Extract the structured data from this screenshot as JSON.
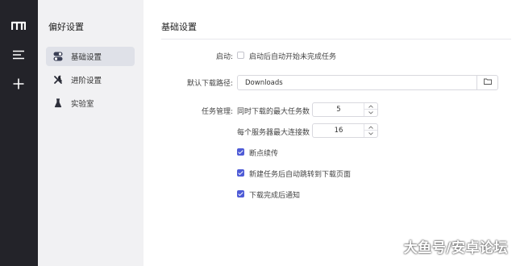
{
  "rail": {
    "items": [
      {
        "icon": "app-logo-icon"
      },
      {
        "icon": "menu-icon"
      },
      {
        "icon": "plus-icon"
      }
    ]
  },
  "sidebar": {
    "title": "偏好设置",
    "items": [
      {
        "label": "基础设置",
        "icon": "toggle-icon",
        "active": true
      },
      {
        "label": "进阶设置",
        "icon": "tools-icon",
        "active": false
      },
      {
        "label": "实验室",
        "icon": "flask-icon",
        "active": false
      }
    ]
  },
  "main": {
    "title": "基础设置",
    "startup": {
      "label": "启动:",
      "option_label": "启动后自动开始未完成任务",
      "checked": false
    },
    "download_path": {
      "label": "默认下载路径:",
      "value": "Downloads",
      "browse_icon": "folder-icon"
    },
    "task_management": {
      "label": "任务管理:",
      "max_tasks_label": "同时下载的最大任务数",
      "max_tasks_value": "5",
      "max_connections_label": "每个服务器最大连接数",
      "max_connections_value": "16"
    },
    "options": [
      {
        "label": "断点续传",
        "checked": true
      },
      {
        "label": "新建任务后自动跳转到下载页面",
        "checked": true
      },
      {
        "label": "下载完成后通知",
        "checked": true
      }
    ]
  },
  "watermark": "大鱼号/安卓论坛",
  "colors": {
    "rail_bg": "#232329",
    "sidebar_bg": "#f1f1f3",
    "active_item_bg": "#dfe1e8",
    "accent": "#4e5bd6"
  }
}
